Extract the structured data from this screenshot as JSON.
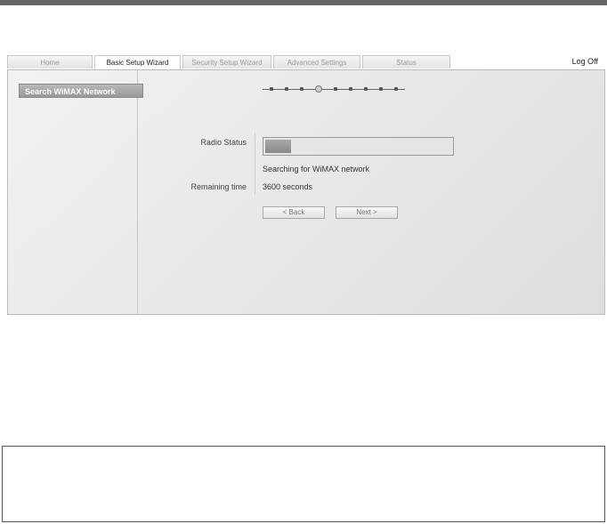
{
  "tabs": [
    {
      "label": "Home",
      "active": false
    },
    {
      "label": "Basic Setup Wizard",
      "active": true
    },
    {
      "label": "Security Setup Wizard",
      "active": false
    },
    {
      "label": "Advanced Settings",
      "active": false
    },
    {
      "label": "Status",
      "active": false
    }
  ],
  "header": {
    "logoff_label": "Log Off"
  },
  "sidebar": {
    "items": [
      {
        "label": "Search WiMAX Network",
        "selected": true
      }
    ]
  },
  "wizard": {
    "total_steps": 9,
    "current_step": 4
  },
  "form": {
    "radio_status_label": "Radio Status",
    "progress_fraction": 0.14,
    "status_message": "Searching for WiMAX network",
    "remaining_time_label": "Remaining time",
    "remaining_time_value": "3600 seconds",
    "back_label": "< Back",
    "next_label": "Next >"
  }
}
